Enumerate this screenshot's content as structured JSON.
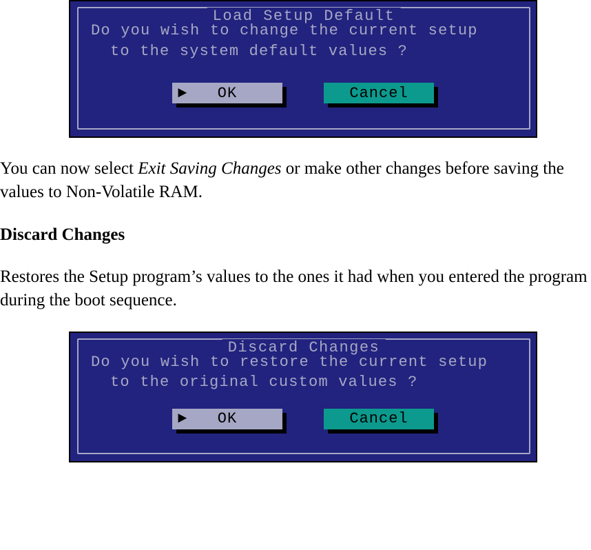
{
  "dialog1": {
    "title": "Load Setup Default",
    "line1": "Do you wish to change the current setup",
    "line2": "to the system default values ?",
    "ok": "OK",
    "cancel": "Cancel"
  },
  "body": {
    "p1a": "You can now select ",
    "p1b": "Exit Saving Changes",
    "p1c": " or make other changes before saving the values to Non-Volatile RAM.",
    "h1": "Discard Changes",
    "p2": "Restores the Setup program’s values to the ones it had when you entered the program during the boot sequence."
  },
  "dialog2": {
    "title": "Discard Changes",
    "line1": "Do you wish to restore the current setup",
    "line2": "to the original custom values ?",
    "ok": "OK",
    "cancel": "Cancel"
  }
}
